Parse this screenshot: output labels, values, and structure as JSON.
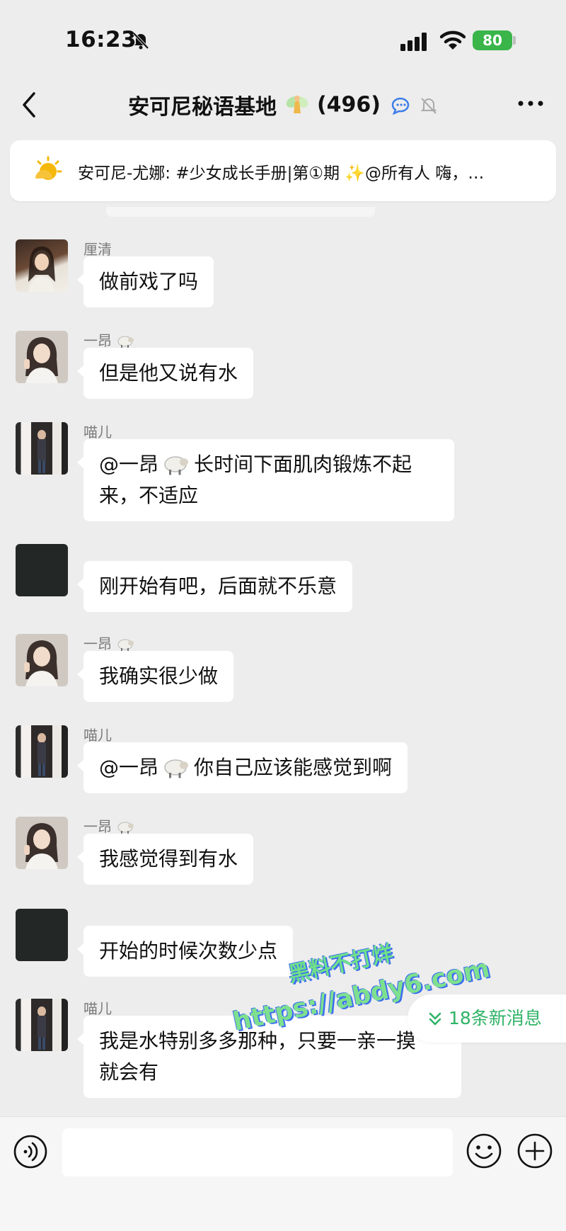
{
  "status_bar": {
    "time": "16:23",
    "battery": "80"
  },
  "header": {
    "title": "安可尼秘语基地",
    "member_count": "(496)"
  },
  "announcement": {
    "text": "安可尼-尤娜: #少女成长手册|第①期 ✨@所有人  嗨，…"
  },
  "messages": [
    {
      "sender": "厘清",
      "text": "做前戏了吗"
    },
    {
      "sender": "一昂",
      "text": "但是他又说有水"
    },
    {
      "sender": "喵儿",
      "mention": "@一昂",
      "text_line1": "长时间下面肌肉锻炼不起",
      "text_line2": "来，不适应"
    },
    {
      "sender": "",
      "text": "刚开始有吧，后面就不乐意"
    },
    {
      "sender": "一昂",
      "text": "我确实很少做"
    },
    {
      "sender": "喵儿",
      "mention": "@一昂",
      "text": "你自己应该能感觉到啊"
    },
    {
      "sender": "一昂",
      "text": "我感觉得到有水"
    },
    {
      "sender": "",
      "text": "开始的时候次数少点"
    },
    {
      "sender": "喵儿",
      "text_line1": "我是水特别多多那种，只要一亲一摸",
      "text_line2": "就会有"
    }
  ],
  "new_messages": "18条新消息",
  "watermark": {
    "line1": "黑料不打烊",
    "line2": "https://abdy6.com"
  },
  "colors": {
    "accent_green": "#2fb366",
    "battery_green": "#39b54a",
    "background": "#ededed"
  }
}
